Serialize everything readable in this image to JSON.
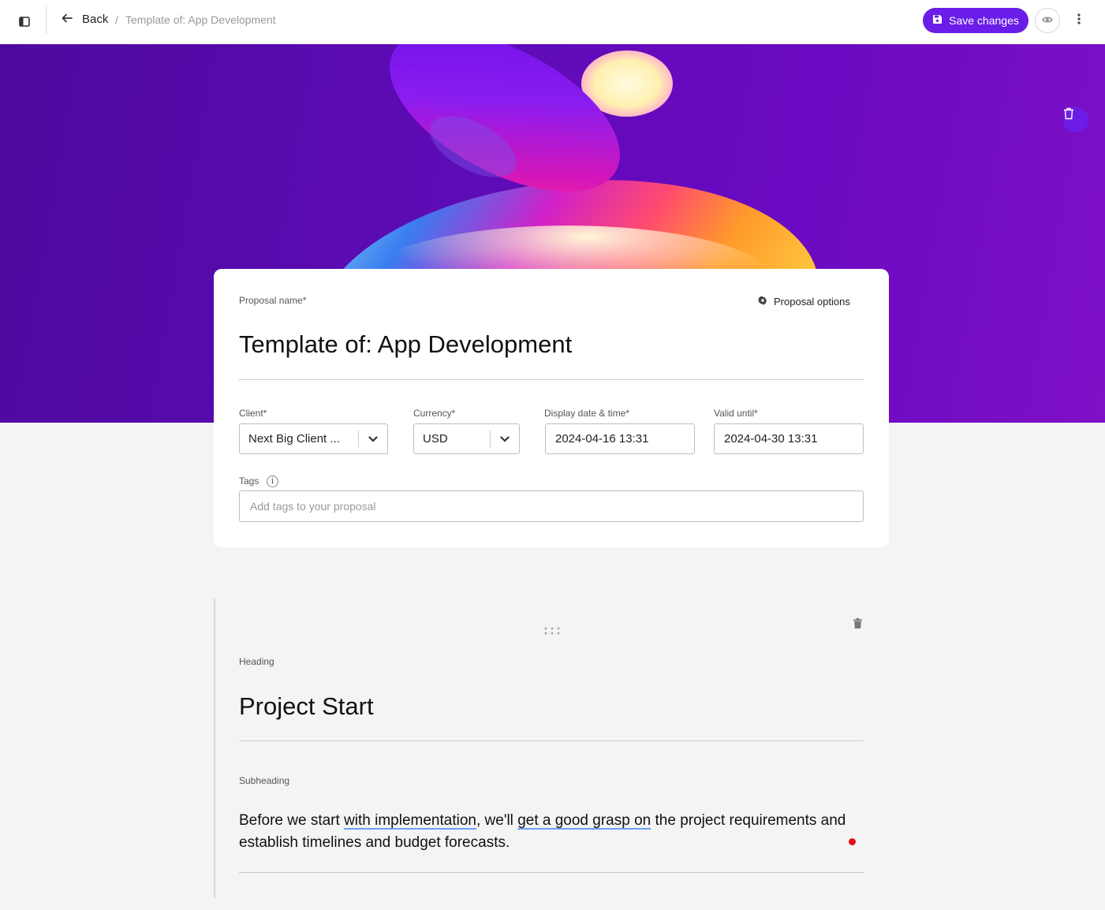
{
  "topbar": {
    "back_label": "Back",
    "breadcrumb_separator": "/",
    "breadcrumb_current": "Template of: App Development",
    "save_label": "Save changes",
    "sidebar_icon": "sidebar-toggle-icon",
    "preview_icon": "eye-icon",
    "more_icon": "more-vertical-icon"
  },
  "colors": {
    "accent": "#6a1de8",
    "hero_bg": "#5d0bb5",
    "spellcheck_underline": "#6aa0f5",
    "alert_dot": "#e0101c"
  },
  "proposal": {
    "name_label": "Proposal name*",
    "name_value": "Template of: App Development",
    "options_label": "Proposal options",
    "client_label": "Client*",
    "client_value": "Next Big Client ...",
    "currency_label": "Currency*",
    "currency_value": "USD",
    "display_date_label": "Display date & time*",
    "display_date_value": "2024-04-16 13:31",
    "valid_until_label": "Valid until*",
    "valid_until_value": "2024-04-30 13:31",
    "tags_label": "Tags",
    "tags_info": "i",
    "tags_placeholder": "Add tags to your proposal"
  },
  "section": {
    "heading_label": "Heading",
    "heading_value": "Project Start",
    "subheading_label": "Subheading",
    "subheading_parts": [
      "Before we start ",
      "with implementation",
      ", we'll ",
      "get a good grasp on",
      " the project requirements and establish timelines and budget forecasts."
    ]
  }
}
